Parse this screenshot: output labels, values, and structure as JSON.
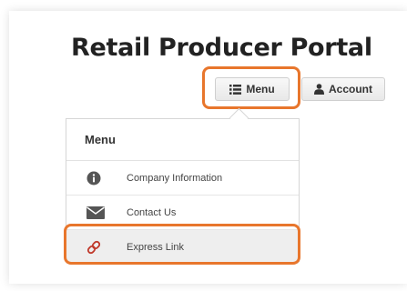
{
  "header": {
    "title": "Retail Producer Portal"
  },
  "buttons": {
    "menu_label": "Menu",
    "account_label": "Account"
  },
  "dropdown": {
    "header": "Menu",
    "items": [
      {
        "label": "Company Information",
        "icon": "info-icon"
      },
      {
        "label": "Contact Us",
        "icon": "envelope-icon"
      },
      {
        "label": "Express Link",
        "icon": "link-icon"
      }
    ]
  },
  "colors": {
    "highlight": "#e8762c",
    "link_icon": "#c0392b"
  }
}
